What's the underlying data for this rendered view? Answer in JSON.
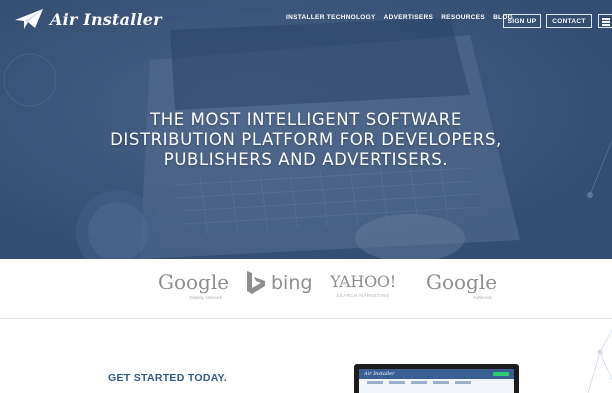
{
  "brand": {
    "name": "Air Installer"
  },
  "nav": {
    "links": [
      "INSTALLER TECHNOLOGY",
      "ADVERTISERS",
      "RESOURCES",
      "BLOG"
    ],
    "sign_up": "SIGN UP",
    "contact": "CONTACT"
  },
  "hero": {
    "headline": [
      "THE MOST INTELLIGENT SOFTWARE",
      "DISTRIBUTION PLATFORM FOR DEVELOPERS,",
      "PUBLISHERS AND ADVERTISERS."
    ]
  },
  "partners": [
    {
      "name": "Google",
      "sub": "Display Network"
    },
    {
      "name": "bing",
      "sub": ""
    },
    {
      "name": "YAHOO!",
      "sub": "SEARCH MARKETING"
    },
    {
      "name": "Google",
      "sub": "AdWords"
    }
  ],
  "cta": {
    "heading": "GET STARTED TODAY."
  },
  "preview": {
    "logo": "Air Installer"
  },
  "icons": {
    "logo": "paper-plane-icon",
    "menu": "hamburger-menu-icon",
    "bing": "bing-logo-icon"
  },
  "colors": {
    "hero": "#4c668c",
    "accent": "#2f5a8c",
    "partner_gray": "#8e8e8e"
  }
}
